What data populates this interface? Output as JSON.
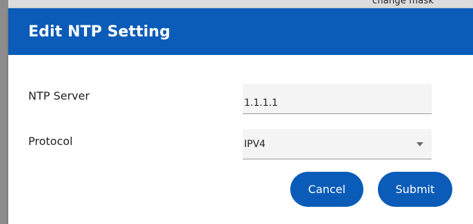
{
  "background": {
    "peek_text": "change mask"
  },
  "dialog": {
    "title": "Edit NTP Setting",
    "fields": {
      "ntp_server": {
        "label": "NTP Server",
        "value": "1.1.1.1"
      },
      "protocol": {
        "label": "Protocol",
        "selected": "IPV4"
      }
    },
    "buttons": {
      "cancel": "Cancel",
      "submit": "Submit"
    }
  },
  "colors": {
    "header": "#0b5cb8",
    "button": "#0b5cb8"
  },
  "icons": {
    "protocol_dropdown": "chevron-down-icon"
  }
}
